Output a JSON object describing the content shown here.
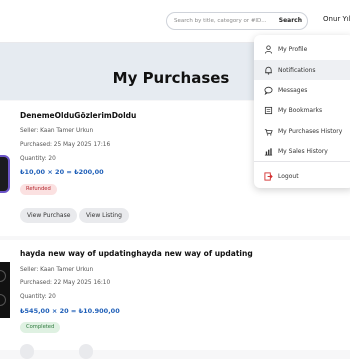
{
  "header": {
    "search_placeholder": "Search by title, category or #ID...",
    "search_button": "Search",
    "user_name": "Onur Yıl"
  },
  "page": {
    "title": "My Purchases"
  },
  "purchases": [
    {
      "title": "DenemeOlduGözlerimDoldu",
      "seller": "Seller: Kaan Tamer Urkun",
      "purchased": "Purchased: 25 May 2025 17:16",
      "quantity": "Quantity: 20",
      "price": "₺10,00 × 20 = ₺200,00",
      "status": "Refunded",
      "view_purchase": "View Purchase",
      "view_listing": "View Listing"
    },
    {
      "title": "hayda new way of updatinghayda new way of updating",
      "seller": "Seller: Kaan Tamer Urkun",
      "purchased": "Purchased: 22 May 2025 16:10",
      "quantity": "Quantity: 20",
      "price": "₺545,00 × 20 = ₺10.900,00",
      "status": "Completed"
    }
  ],
  "menu": {
    "items": [
      {
        "label": "My Profile",
        "icon": "user-icon"
      },
      {
        "label": "Notifications",
        "icon": "bell-icon"
      },
      {
        "label": "Messages",
        "icon": "chat-bubble-icon"
      },
      {
        "label": "My Bookmarks",
        "icon": "bookmark-icon"
      },
      {
        "label": "My Purchases History",
        "icon": "basket-icon"
      },
      {
        "label": "My Sales History",
        "icon": "sales-chart-icon"
      },
      {
        "label": "Logout",
        "icon": "logout-icon"
      }
    ],
    "logout_color": "#d32f2f"
  }
}
